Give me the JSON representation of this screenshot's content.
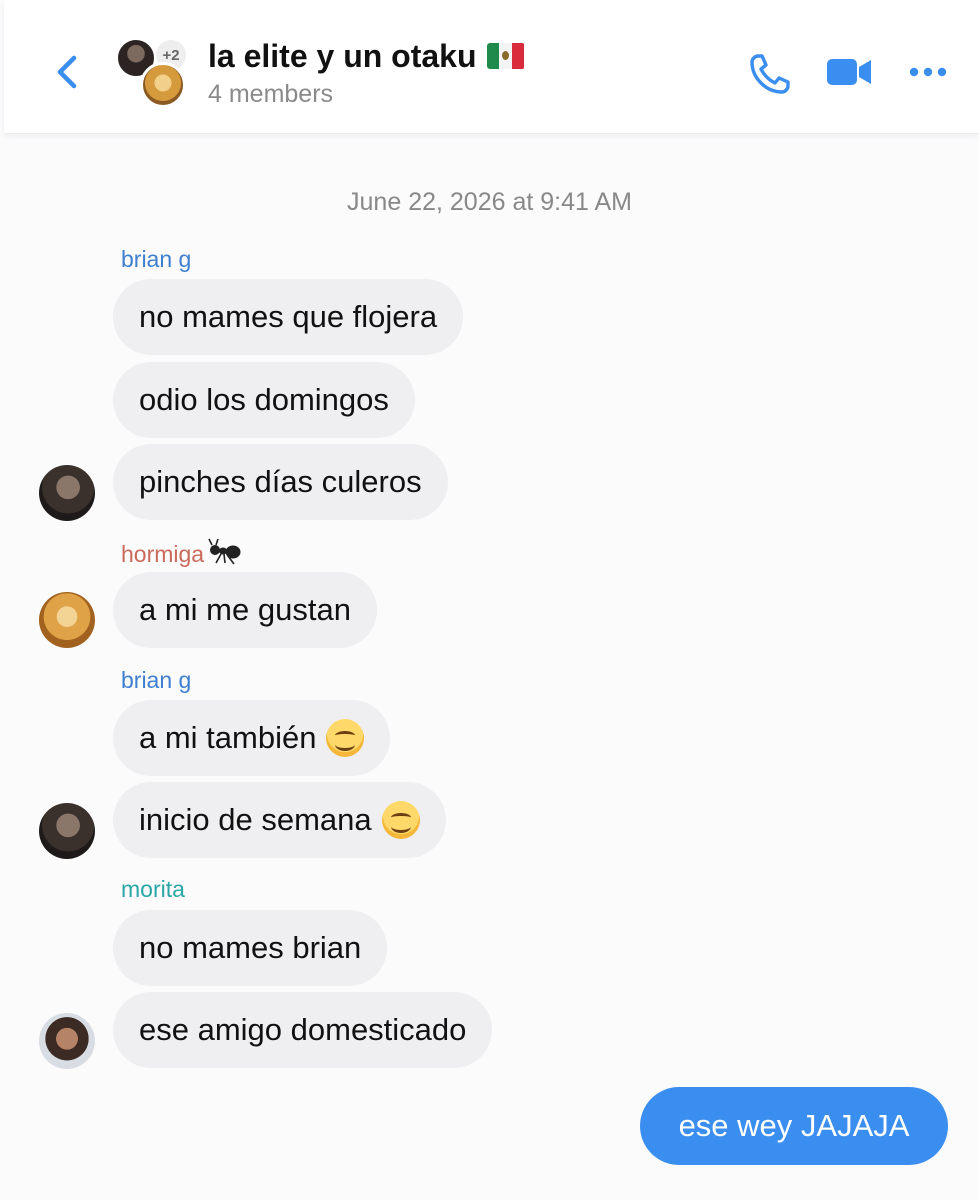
{
  "header": {
    "title": "la elite y un otaku",
    "members": "4 members",
    "avatar_badge": "+2",
    "icons": {
      "back": "chevron-left-icon",
      "call": "phone-icon",
      "video": "video-camera-icon",
      "more": "more-horizontal-icon"
    },
    "accent_color": "#3a8ef0"
  },
  "timestamp": "June 22, 2026 at 9:41 AM",
  "messages": [
    {
      "sender": "brian g",
      "text": "no mames que flojera"
    },
    {
      "text": "odio los domingos"
    },
    {
      "text": "pinches días culeros"
    },
    {
      "sender": "hormiga",
      "text": "a mi me gustan"
    },
    {
      "sender": "brian g",
      "text": "a mi también"
    },
    {
      "text": "inicio de semana"
    },
    {
      "sender": "morita",
      "text": "no mames brian"
    },
    {
      "text": "ese amigo domesticado"
    }
  ],
  "own_message": {
    "text": "ese wey JAJAJA"
  }
}
